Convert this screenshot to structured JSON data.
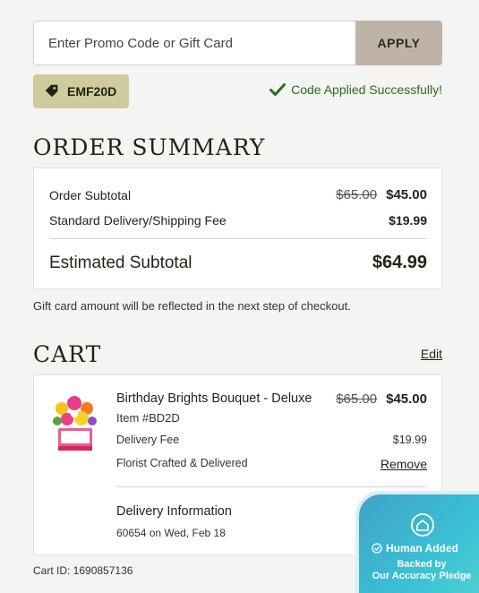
{
  "promo": {
    "placeholder": "Enter Promo Code or Gift Card",
    "apply_label": "APPLY",
    "applied_code": "EMF20D",
    "status_text": "Code Applied Successfully!"
  },
  "summary": {
    "title": "ORDER SUMMARY",
    "subtotal_label": "Order Subtotal",
    "subtotal_original": "$65.00",
    "subtotal_price": "$45.00",
    "shipping_label": "Standard Delivery/Shipping Fee",
    "shipping_price": "$19.99",
    "estimated_label": "Estimated Subtotal",
    "estimated_price": "$64.99",
    "note": "Gift card amount will be reflected in the next step of checkout."
  },
  "cart": {
    "title": "CART",
    "edit_label": "Edit",
    "item": {
      "name": "Birthday Brights Bouquet - Deluxe",
      "original_price": "$65.00",
      "price": "$45.00",
      "item_id": "Item #BD2D",
      "delivery_fee_label": "Delivery Fee",
      "delivery_fee": "$19.99",
      "fulfillment": "Florist Crafted & Delivered",
      "remove_label": "Remove"
    },
    "delivery": {
      "title": "Delivery Information",
      "detail": "60654 on Wed, Feb 18"
    },
    "cart_id": "Cart ID: 1690857136"
  },
  "badge": {
    "main": "Human Added",
    "sub_line1": "Backed by",
    "sub_line2": "Our Accuracy Pledge"
  },
  "icons": {
    "tag": "tag-icon",
    "check": "check-icon",
    "badge_home": "home-shield-icon",
    "badge_check": "check-circle-icon"
  },
  "colors": {
    "apply_button": "#bfb2a7",
    "code_chip": "#cfcb9c",
    "success": "#2e6b1f",
    "badge": "#3bb4d2"
  }
}
